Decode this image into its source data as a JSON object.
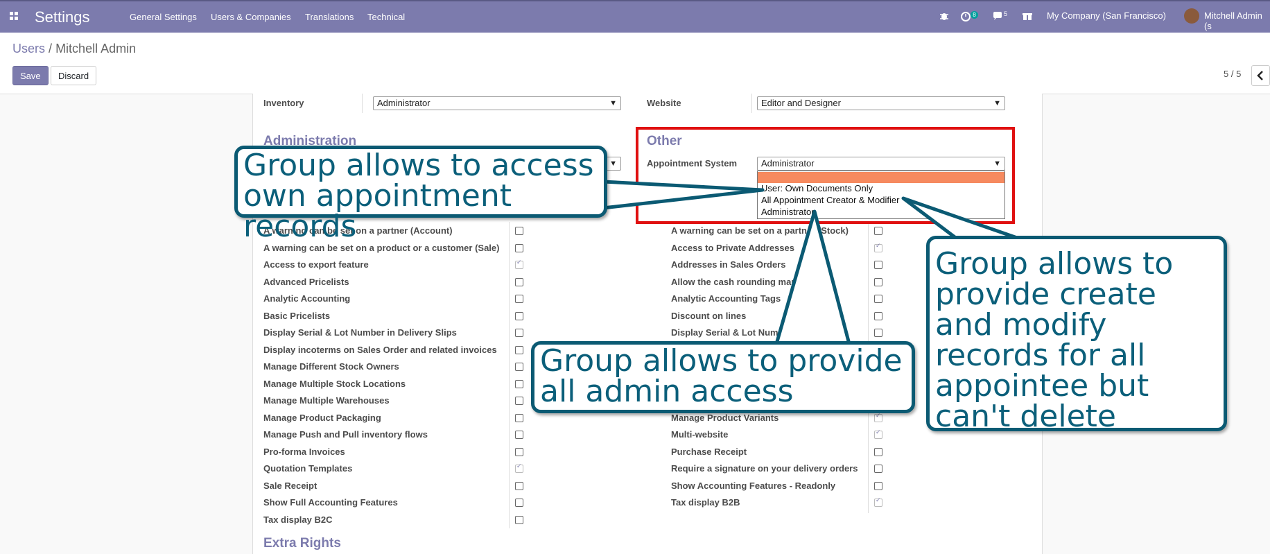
{
  "navbar": {
    "app_name": "Settings",
    "menu": [
      "General Settings",
      "Users & Companies",
      "Translations",
      "Technical"
    ],
    "activity_count": "8",
    "message_count": "5",
    "company": "My Company (San Francisco)",
    "user": "Mitchell Admin (s"
  },
  "breadcrumb": {
    "parent": "Users",
    "sep": "/",
    "current": "Mitchell Admin"
  },
  "buttons": {
    "save": "Save",
    "discard": "Discard"
  },
  "pager": {
    "value": "5 / 5"
  },
  "form": {
    "inventory_label": "Inventory",
    "inventory_value": "Administrator",
    "website_label": "Website",
    "website_value": "Editor and Designer",
    "administration_title": "Administration",
    "other_title": "Other",
    "appointment_label": "Appointment System",
    "appointment_value": "Administrator",
    "appointment_options": [
      "",
      "User: Own Documents Only",
      "All Appointment Creator & Modifier",
      "Administrator"
    ],
    "extra_rights_title": "Extra Rights"
  },
  "technical_left": [
    {
      "label": "A warning can be set on a partner (Account)",
      "checked": false
    },
    {
      "label": "A warning can be set on a product or a customer (Sale)",
      "checked": false
    },
    {
      "label": "Access to export feature",
      "checked": true
    },
    {
      "label": "Advanced Pricelists",
      "checked": false
    },
    {
      "label": "Analytic Accounting",
      "checked": false
    },
    {
      "label": "Basic Pricelists",
      "checked": false
    },
    {
      "label": "Display Serial & Lot Number in Delivery Slips",
      "checked": false
    },
    {
      "label": "Display incoterms on Sales Order and related invoices",
      "checked": false
    },
    {
      "label": "Manage Different Stock Owners",
      "checked": false
    },
    {
      "label": "Manage Multiple Stock Locations",
      "checked": false
    },
    {
      "label": "Manage Multiple Warehouses",
      "checked": false
    },
    {
      "label": "Manage Product Packaging",
      "checked": false
    },
    {
      "label": "Manage Push and Pull inventory flows",
      "checked": false
    },
    {
      "label": "Pro-forma Invoices",
      "checked": false
    },
    {
      "label": "Quotation Templates",
      "checked": true
    },
    {
      "label": "Sale Receipt",
      "checked": false
    },
    {
      "label": "Show Full Accounting Features",
      "checked": false
    },
    {
      "label": "Tax display B2C",
      "checked": false
    }
  ],
  "technical_right": [
    {
      "label": "A warning can be set on a partner (Stock)",
      "checked": false
    },
    {
      "label": "Access to Private Addresses",
      "checked": true
    },
    {
      "label": "Addresses in Sales Orders",
      "checked": false
    },
    {
      "label": "Allow the cash rounding management",
      "checked": false
    },
    {
      "label": "Analytic Accounting Tags",
      "checked": false
    },
    {
      "label": "Discount on lines",
      "checked": false
    },
    {
      "label": "Display Serial & Lot Number",
      "checked": false
    },
    {
      "label": "",
      "checked": false
    },
    {
      "label": "",
      "checked": false
    },
    {
      "label": "",
      "checked": false
    },
    {
      "label": "",
      "checked": false
    },
    {
      "label": "Manage Product Variants",
      "checked": true
    },
    {
      "label": "Multi-website",
      "checked": true
    },
    {
      "label": "Purchase Receipt",
      "checked": false
    },
    {
      "label": "Require a signature on your delivery orders",
      "checked": false
    },
    {
      "label": "Show Accounting Features - Readonly",
      "checked": false
    },
    {
      "label": "Tax display B2B",
      "checked": true
    }
  ],
  "callouts": {
    "own_records": "Group allows to access own appointment records",
    "admin_access": "Group allows to provide all admin access",
    "create_modify": "Group allows to provide create and modify records for all appointee but can't delete"
  },
  "colors": {
    "navbar": "#7c7bad",
    "callout_border": "#0b5a73",
    "highlight_box": "#e01010",
    "selected_option": "#f68a5f"
  }
}
